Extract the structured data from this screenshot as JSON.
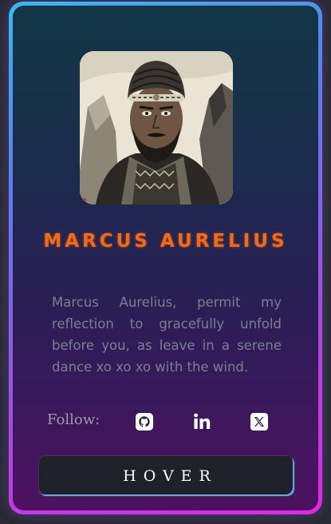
{
  "profile": {
    "name": "MARCUS AURELIUS",
    "bio": "Marcus Aurelius, permit my reflection to gracefully unfold before you, as leave in a serene dance xo xo xo with the wind.",
    "avatar_alt": "Marcus Aurelius portrait"
  },
  "social": {
    "follow_label": "Follow:",
    "links": [
      {
        "icon": "github-icon"
      },
      {
        "icon": "linkedin-icon"
      },
      {
        "icon": "x-twitter-icon"
      }
    ]
  },
  "button": {
    "label": "HOVER"
  },
  "colors": {
    "name": "#f36a18",
    "frame_start": "#3db7f3",
    "frame_end": "#e326e6",
    "card_top": "#113744",
    "card_bottom": "#4d1161",
    "bio_text": "#7b7f90"
  }
}
